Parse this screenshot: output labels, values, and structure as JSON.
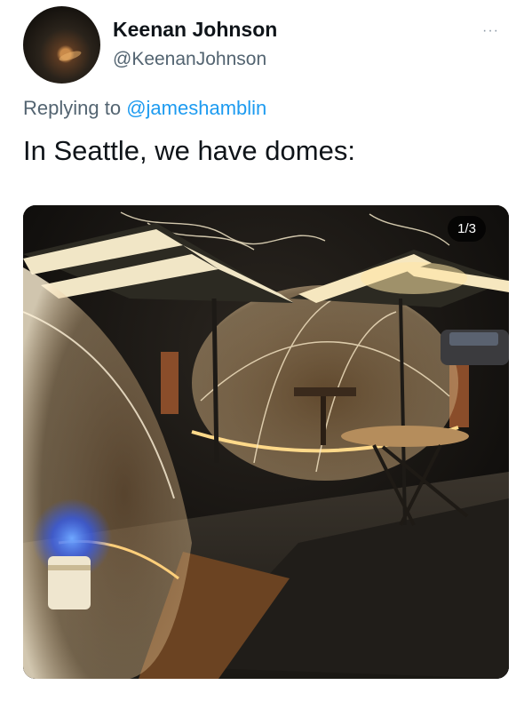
{
  "author": {
    "name": "Keenan Johnson",
    "handle": "@KeenanJohnson"
  },
  "reply": {
    "prefix": "Replying to",
    "mention": "@jameshamblin"
  },
  "tweet": {
    "text": "In Seattle, we have domes:"
  },
  "media": {
    "counter": "1/3",
    "description_icon": "photo-outdoor-dining-domes"
  },
  "menu": {
    "icon": "more-options-icon",
    "label": "···"
  },
  "colors": {
    "text_primary": "#0f1419",
    "text_secondary": "#536471",
    "link": "#1d9bf0"
  }
}
